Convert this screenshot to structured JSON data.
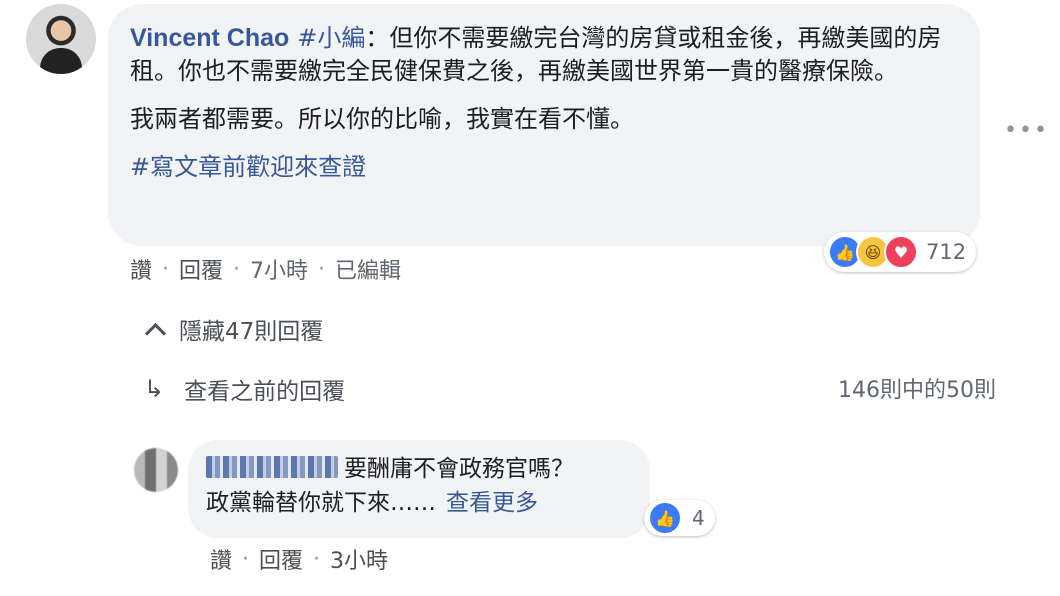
{
  "main_comment": {
    "author": "Vincent Chao",
    "tag": "#小編",
    "line1_rest": "：但你不需要繳完台灣的房貸或租金後，再繳美國的房租。你也不需要繳完全民健保費之後，再繳美國世界第一貴的醫療保險。",
    "paragraph2": "我兩者都需要。所以你的比喻，我實在看不懂。",
    "hashtag_line": "#寫文章前歡迎來查證",
    "reactions_count": "712",
    "actions": {
      "like": "讚",
      "reply": "回覆",
      "time": "7小時",
      "edited": "已編輯"
    }
  },
  "hide_replies": "隱藏47則回覆",
  "view_previous": "查看之前的回覆",
  "count_of": "146則中的50則",
  "reply": {
    "text_line1": "要酬庸不會政務官嗎？",
    "text_line2": "政黨輪替你就下來……",
    "see_more": "查看更多",
    "reactions_count": "4",
    "actions": {
      "like": "讚",
      "reply": "回覆",
      "time": "3小時"
    }
  },
  "icons": {
    "more": "more-options-icon",
    "like": "like-reaction-icon",
    "haha": "haha-reaction-icon",
    "love": "love-reaction-icon",
    "chevron": "chevron-up-icon",
    "reply_arrow": "reply-arrow-icon"
  },
  "colors": {
    "link_blue": "#365899",
    "bubble_bg": "#f2f3f5",
    "meta_gray": "#606770"
  }
}
